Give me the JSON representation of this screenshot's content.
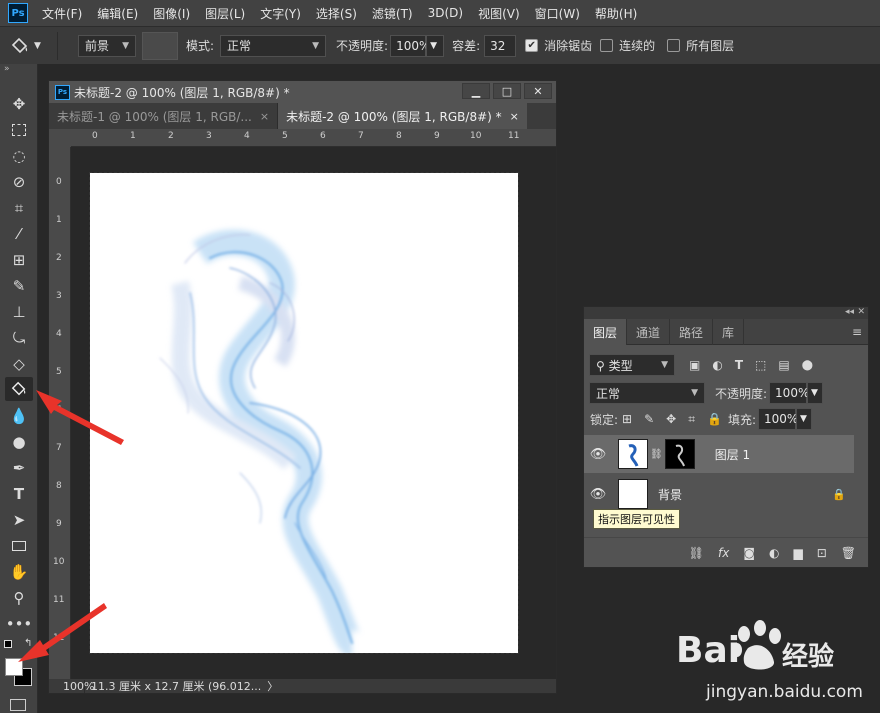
{
  "menubar": {
    "logo": "Ps",
    "items": [
      "文件(F)",
      "编辑(E)",
      "图像(I)",
      "图层(L)",
      "文字(Y)",
      "选择(S)",
      "滤镜(T)",
      "3D(D)",
      "视图(V)",
      "窗口(W)",
      "帮助(H)"
    ]
  },
  "options": {
    "tool_icon": "paint-bucket-icon",
    "fill_source": "前景",
    "mode_label": "模式:",
    "mode_value": "正常",
    "opacity_label": "不透明度:",
    "opacity_value": "100%",
    "tolerance_label": "容差:",
    "tolerance_value": "32",
    "antialias_label": "消除锯齿",
    "antialias_checked": true,
    "contiguous_label": "连续的",
    "contiguous_checked": false,
    "all_layers_label": "所有图层",
    "all_layers_checked": false
  },
  "tools": {
    "collapse": "»",
    "items": [
      "move",
      "marquee",
      "lasso",
      "quick-select",
      "crop",
      "eyedropper",
      "healing",
      "brush",
      "stamp",
      "history-brush",
      "eraser",
      "paint-bucket",
      "blur",
      "dodge",
      "pen",
      "type",
      "path-select",
      "rectangle",
      "hand",
      "zoom",
      "more"
    ],
    "active": "paint-bucket"
  },
  "document": {
    "title": "未标题-2 @ 100% (图层 1, RGB/8#) *",
    "tabs": [
      {
        "label": "未标题-1 @ 100% (图层 1, RGB/...",
        "close": "×"
      },
      {
        "label": "未标题-2 @ 100% (图层 1, RGB/8#) *",
        "close": "×"
      }
    ],
    "ruler_top": [
      "0",
      "1",
      "2",
      "3",
      "4",
      "5",
      "6",
      "7",
      "8",
      "9",
      "10",
      "11"
    ],
    "ruler_left": [
      "0",
      "1",
      "2",
      "3",
      "4",
      "5",
      "6",
      "7",
      "8",
      "9",
      "10",
      "11",
      "12"
    ],
    "zoom": "100%",
    "size_info": "11.3 厘米 x 12.7 厘米 (96.012...",
    "status_arrow": "〉"
  },
  "layers_panel": {
    "tabs": [
      "图层",
      "通道",
      "路径",
      "库"
    ],
    "filter_label": "类型",
    "blend_mode": "正常",
    "opacity_label": "不透明度:",
    "opacity_value": "100%",
    "lock_label": "锁定:",
    "fill_label": "填充:",
    "fill_value": "100%",
    "layers": [
      {
        "name": "图层 1",
        "selected": true
      },
      {
        "name": "背景",
        "selected": false
      }
    ],
    "tooltip": "指示图层可见性",
    "bottom_icons": [
      "link-icon",
      "fx-icon",
      "mask-icon",
      "adjustment-icon",
      "folder-icon",
      "new-layer-icon",
      "trash-icon"
    ],
    "fx_label": "fx"
  },
  "watermark": {
    "brand": "Bai",
    "brand_tail": "经验",
    "url": "jingyan.baidu.com"
  },
  "colors": {
    "accent": "#31a8ff",
    "arrow": "#e8332a"
  }
}
